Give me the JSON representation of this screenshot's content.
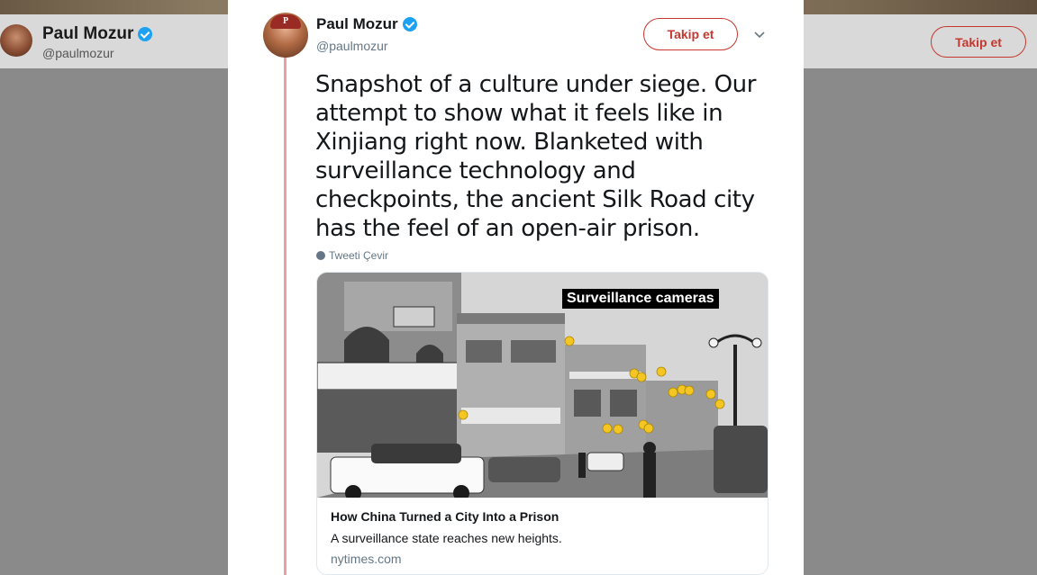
{
  "background": {
    "profile_name": "Paul Mozur",
    "profile_handle": "@paulmozur",
    "follow_label": "Takip et"
  },
  "tweet": {
    "author_name": "Paul Mozur",
    "author_handle": "@paulmozur",
    "follow_label": "Takip et",
    "text": "Snapshot of a culture under siege. Our attempt to show what it feels like in Xinjiang right now. Blanketed with surveillance technology and checkpoints, the ancient Silk Road city has the feel of an open-air prison.",
    "translate_label": "Tweeti Çevir",
    "verified": true
  },
  "card": {
    "image_caption": "Surveillance cameras",
    "title": "How China Turned a City Into a Prison",
    "description": "A surveillance state reaches new heights.",
    "domain": "nytimes.com"
  },
  "colors": {
    "follow_red": "#c5372f",
    "verified_blue": "#1da1f2",
    "camera_marker_yellow": "#f3c623"
  },
  "icons": [
    "verified-badge-icon",
    "chevron-down-icon",
    "globe-icon"
  ]
}
